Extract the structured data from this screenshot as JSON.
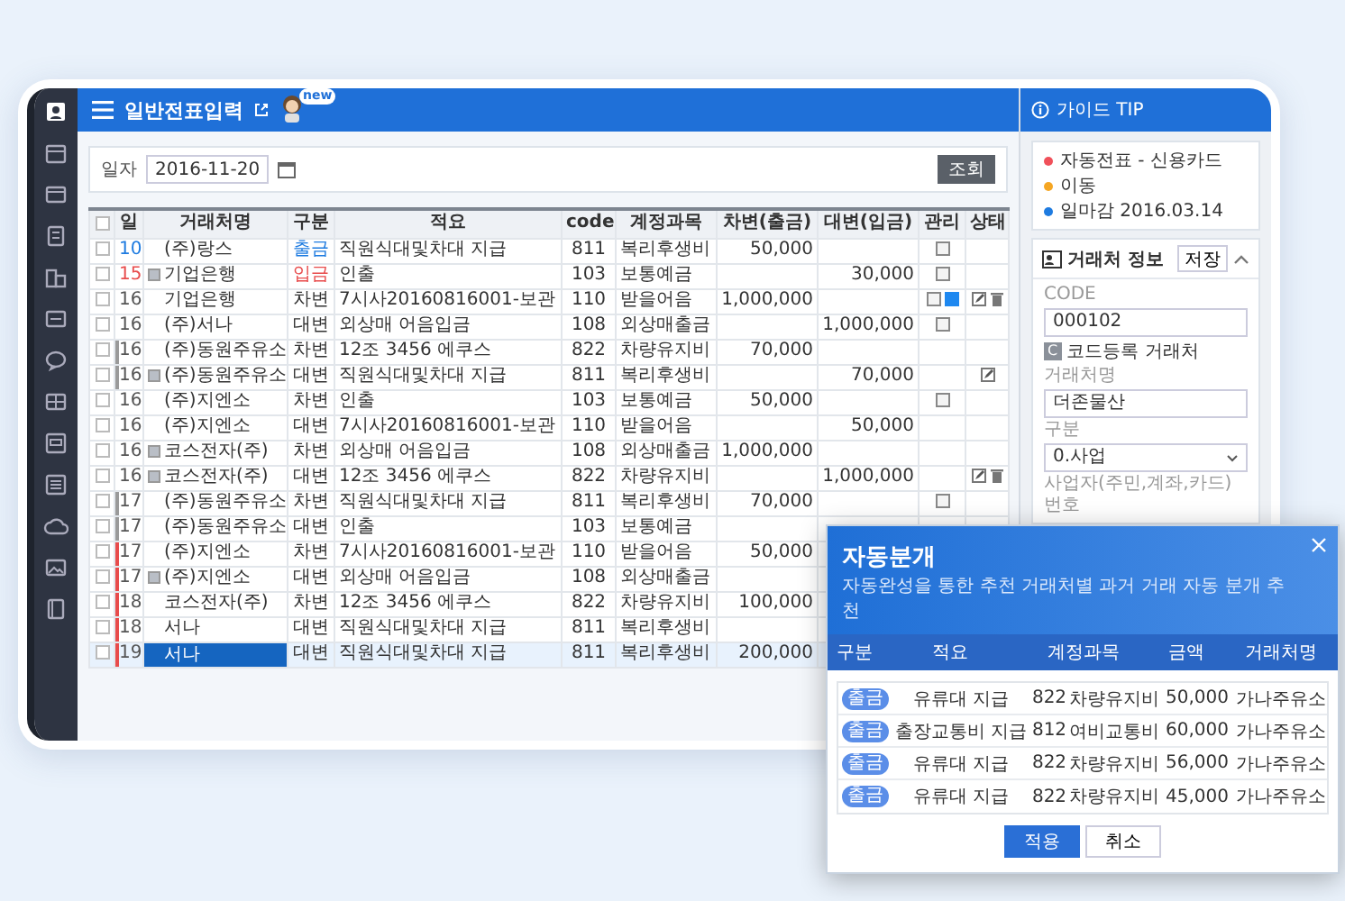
{
  "header": {
    "title": "일반전표입력",
    "badge": "new"
  },
  "toolbar": {
    "date_label": "일자",
    "date": "2016-11-20",
    "search_button": "조회"
  },
  "table": {
    "columns": [
      "일",
      "거래처명",
      "구분",
      "적요",
      "code",
      "계정과목",
      "차변(출금)",
      "대변(입금)",
      "관리",
      "상태"
    ],
    "header_checked": false,
    "rows": [
      {
        "day": "10",
        "vendor": "(주)랑스",
        "type": "출금",
        "kind": "withdrawal",
        "memo": "직원식대및차대 지급",
        "code": "811",
        "account": "복리후생비",
        "debit": "50,000",
        "memo_icon": true,
        "checked": false,
        "selected": false
      },
      {
        "day": "15",
        "vendor": "기업은행",
        "vendor_icon": true,
        "type": "입금",
        "kind": "deposit",
        "memo": "인출",
        "code": "103",
        "account": "보통예금",
        "credit": "30,000",
        "memo_icon": true,
        "checked": false,
        "selected": false
      },
      {
        "day": "16",
        "vendor": "기업은행",
        "type": "차변",
        "kind": "transfer",
        "memo": "7시사20160816001-보관",
        "code": "110",
        "account": "받을어음",
        "debit": "1,000,000",
        "memo_icon": true,
        "memo_active": true,
        "edit_icon": true,
        "delete_icon": true,
        "checked": false,
        "selected": false
      },
      {
        "day": "16",
        "vendor": "(주)서나",
        "type": "대변",
        "kind": "transfer",
        "memo": "외상매 어음입금",
        "code": "108",
        "account": "외상매출금",
        "credit": "1,000,000",
        "memo_icon": true,
        "checked": false,
        "selected": false
      },
      {
        "day": "16",
        "vendor": "(주)동원주유소",
        "type": "차변",
        "kind": "transfer",
        "memo": "12조 3456 에쿠스",
        "code": "822",
        "account": "차량유지비",
        "debit": "70,000",
        "color": "#9a9a9a",
        "checked": false,
        "selected": false
      },
      {
        "day": "16",
        "vendor": "(주)동원주유소",
        "vendor_icon": true,
        "type": "대변",
        "kind": "transfer",
        "memo": "직원식대및차대 지급",
        "code": "811",
        "account": "복리후생비",
        "credit": "70,000",
        "edit_icon": true,
        "color": "#9a9a9a",
        "checked": false,
        "selected": false
      },
      {
        "day": "16",
        "vendor": "(주)지엔소",
        "type": "차변",
        "kind": "transfer",
        "memo": "인출",
        "code": "103",
        "account": "보통예금",
        "debit": "50,000",
        "memo_icon": true,
        "checked": false,
        "selected": false
      },
      {
        "day": "16",
        "vendor": "(주)지엔소",
        "type": "대변",
        "kind": "transfer",
        "memo": "7시사20160816001-보관",
        "code": "110",
        "account": "받을어음",
        "credit": "50,000",
        "checked": false,
        "selected": false
      },
      {
        "day": "16",
        "vendor": "코스전자(주)",
        "vendor_icon": true,
        "type": "차변",
        "kind": "transfer",
        "memo": "외상매 어음입금",
        "code": "108",
        "account": "외상매출금",
        "debit": "1,000,000",
        "checked": false,
        "selected": false
      },
      {
        "day": "16",
        "vendor": "코스전자(주)",
        "vendor_icon": true,
        "type": "대변",
        "kind": "transfer",
        "memo": "12조 3456 에쿠스",
        "code": "822",
        "account": "차량유지비",
        "credit": "1,000,000",
        "edit_icon": true,
        "delete_icon": true,
        "checked": false,
        "selected": false
      },
      {
        "day": "17",
        "vendor": "(주)동원주유소",
        "type": "차변",
        "kind": "transfer",
        "memo": "직원식대및차대 지급",
        "code": "811",
        "account": "복리후생비",
        "debit": "70,000",
        "memo_icon": true,
        "color": "#9a9a9a",
        "checked": false,
        "selected": false
      },
      {
        "day": "17",
        "vendor": "(주)동원주유소",
        "type": "대변",
        "kind": "transfer",
        "memo": "인출",
        "code": "103",
        "account": "보통예금",
        "color": "#9a9a9a",
        "checked": false,
        "selected": false
      },
      {
        "day": "17",
        "vendor": "(주)지엔소",
        "type": "차변",
        "kind": "transfer",
        "memo": "7시사20160816001-보관",
        "code": "110",
        "account": "받을어음",
        "debit": "50,000",
        "color": "#e84c4c",
        "checked": false,
        "selected": false
      },
      {
        "day": "17",
        "vendor": "(주)지엔소",
        "vendor_icon": true,
        "type": "대변",
        "kind": "transfer",
        "memo": "외상매 어음입금",
        "code": "108",
        "account": "외상매출금",
        "color": "#e84c4c",
        "checked": false,
        "selected": false
      },
      {
        "day": "18",
        "vendor": "코스전자(주)",
        "type": "차변",
        "kind": "transfer",
        "memo": "12조 3456 에쿠스",
        "code": "822",
        "account": "차량유지비",
        "debit": "100,000",
        "color": "#e84c4c",
        "checked": false,
        "selected": false
      },
      {
        "day": "18",
        "vendor": "서나",
        "type": "대변",
        "kind": "transfer",
        "memo": "직원식대및차대 지급",
        "code": "811",
        "account": "복리후생비",
        "color": "#e84c4c",
        "checked": false,
        "selected": false
      },
      {
        "day": "19",
        "vendor": "서나",
        "type": "대변",
        "kind": "transfer",
        "memo": "직원식대및차대 지급",
        "code": "811",
        "account": "복리후생비",
        "debit": "200,000",
        "color": "#e84c4c",
        "checked": false,
        "selected": true
      }
    ]
  },
  "guide": {
    "title": "가이드 TIP",
    "tips": [
      {
        "text": "자동전표 - 신용카드",
        "color": "#f0505a"
      },
      {
        "text": "이동",
        "color": "#f5a623"
      },
      {
        "text": "일마감 2016.03.14",
        "color": "#1e7be0"
      }
    ],
    "card": {
      "title": "거래처 정보",
      "save_button": "저장",
      "expanded": true,
      "code_label": "CODE",
      "code_value": "000102",
      "code_badge": "C",
      "code_note": "코드등록 거래처",
      "vendor_label": "거래처명",
      "vendor_value": "더존물산",
      "type_label": "구분",
      "type_value": "0.사업",
      "id_label": "사업자(주민,계좌,카드)번호"
    }
  },
  "popup": {
    "title": "자동분개",
    "subtitle": "자동완성을 통한 추천 거래처별 과거 거래 자동 분개 추천",
    "columns": [
      "구분",
      "적요",
      "계정과목",
      "금액",
      "거래처명"
    ],
    "rows": [
      {
        "type": "출금",
        "memo": "유류대 지급",
        "code": "822",
        "account": "차량유지비",
        "amount": "50,000",
        "vendor": "가나주유소"
      },
      {
        "type": "출금",
        "memo": "출장교통비 지급",
        "code": "812",
        "account": "여비교통비",
        "amount": "60,000",
        "vendor": "가나주유소"
      },
      {
        "type": "출금",
        "memo": "유류대 지급",
        "code": "822",
        "account": "차량유지비",
        "amount": "56,000",
        "vendor": "가나주유소"
      },
      {
        "type": "출금",
        "memo": "유류대 지급",
        "code": "822",
        "account": "차량유지비",
        "amount": "45,000",
        "vendor": "가나주유소"
      }
    ],
    "apply_button": "적용",
    "cancel_button": "취소"
  }
}
